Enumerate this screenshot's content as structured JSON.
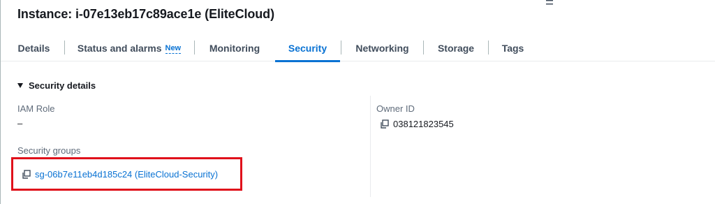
{
  "header": {
    "title": "Instance: i-07e13eb17c89ace1e (EliteCloud)"
  },
  "tabs": [
    {
      "label": "Details"
    },
    {
      "label": "Status and alarms",
      "badge": "New"
    },
    {
      "label": "Monitoring"
    },
    {
      "label": "Security",
      "active": true
    },
    {
      "label": "Networking"
    },
    {
      "label": "Storage"
    },
    {
      "label": "Tags"
    }
  ],
  "security_details": {
    "section_title": "Security details",
    "iam_role_label": "IAM Role",
    "iam_role_value": "–",
    "owner_id_label": "Owner ID",
    "owner_id_value": "038121823545",
    "security_groups_label": "Security groups",
    "security_group_link": "sg-06b7e11eb4d185c24 (EliteCloud-Security)"
  },
  "colors": {
    "accent": "#0972d3",
    "highlight": "#e0111b",
    "text": "#16191f",
    "muted": "#5f6b7a"
  },
  "icons": {
    "copy": "copy-icon",
    "menu": "menu-icon",
    "caret": "caret-down-icon"
  }
}
